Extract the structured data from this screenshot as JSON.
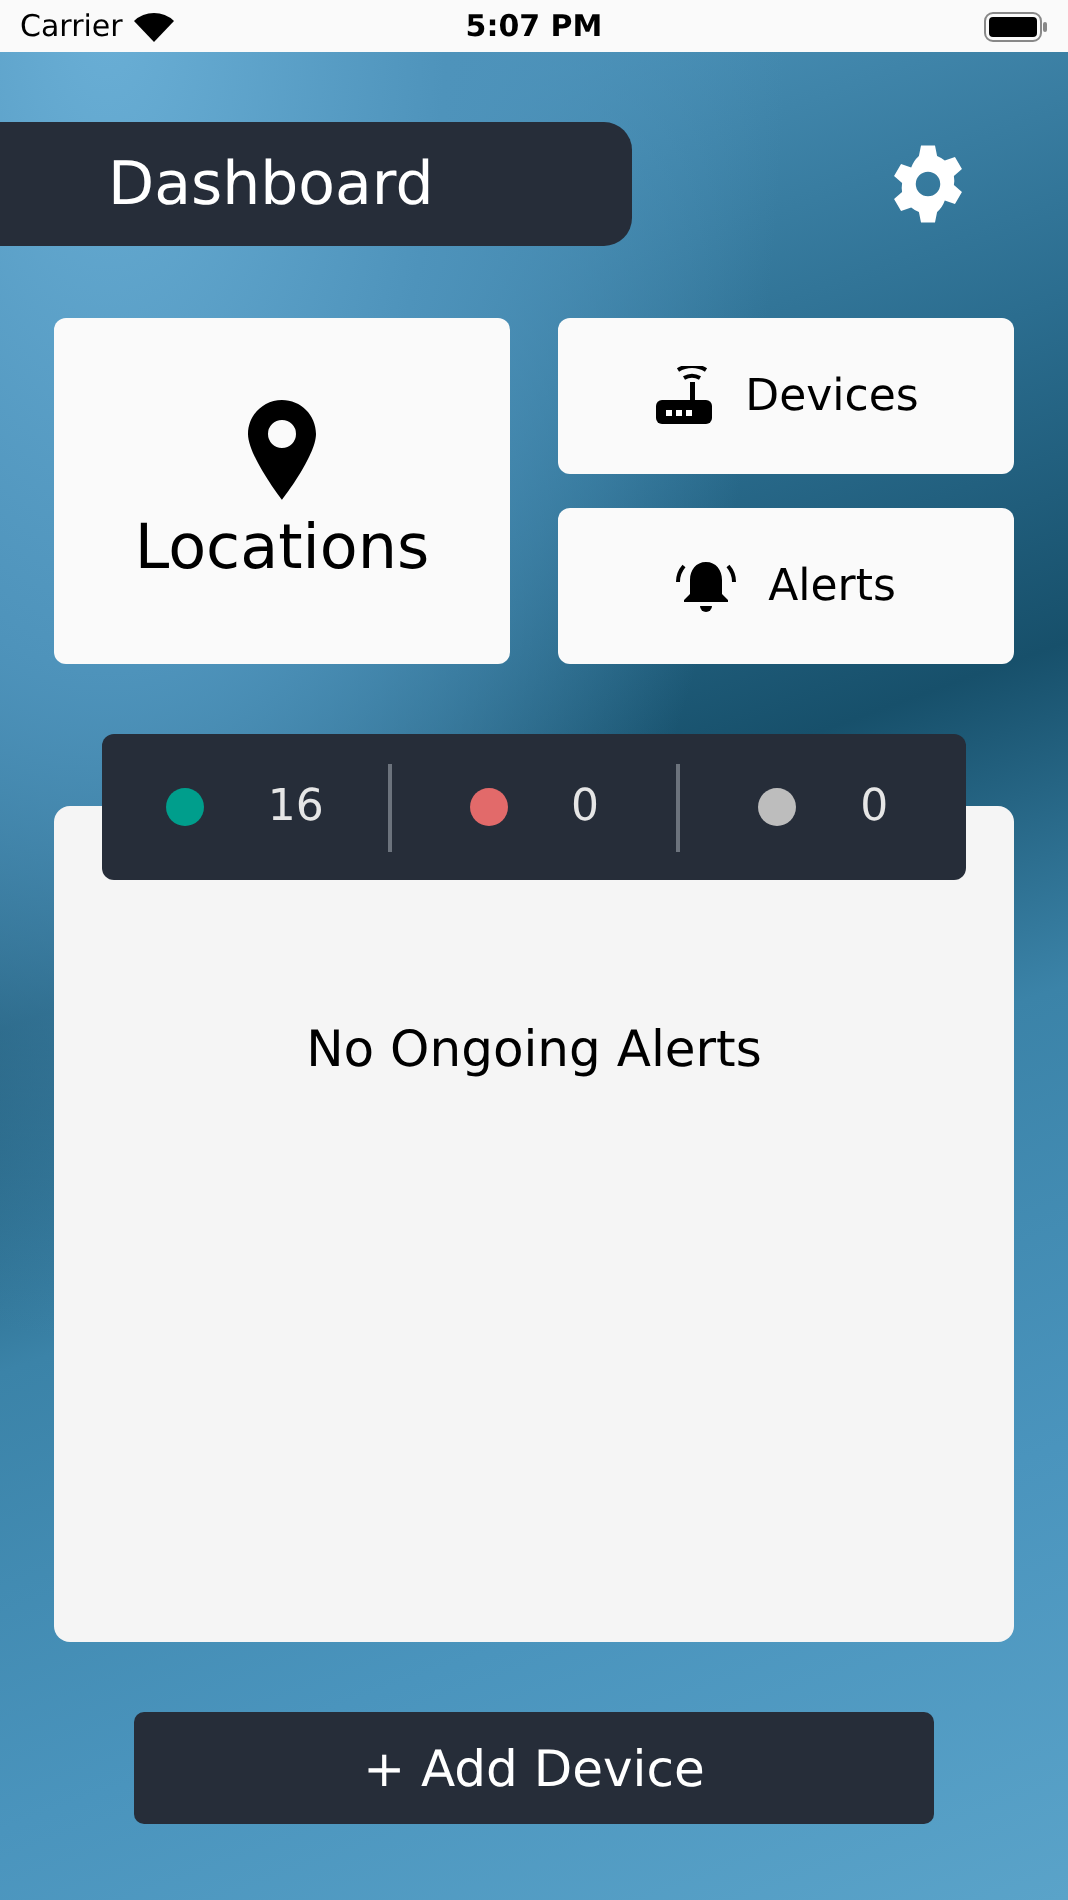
{
  "status_bar": {
    "carrier": "Carrier",
    "time": "5:07 PM"
  },
  "header": {
    "title": "Dashboard"
  },
  "tiles": [
    {
      "kind": "location",
      "label": "Locations"
    },
    {
      "kind": "devices",
      "label": "Devices"
    },
    {
      "kind": "alerts",
      "label": "Alerts"
    }
  ],
  "status_counts": [
    {
      "color": "#009e8c",
      "count": "16"
    },
    {
      "color": "#e26a6a",
      "count": "0"
    },
    {
      "color": "#bdbdbd",
      "count": "0"
    }
  ],
  "alerts_panel": {
    "message": "No Ongoing Alerts"
  },
  "add_button": {
    "label": "+ Add Device"
  }
}
